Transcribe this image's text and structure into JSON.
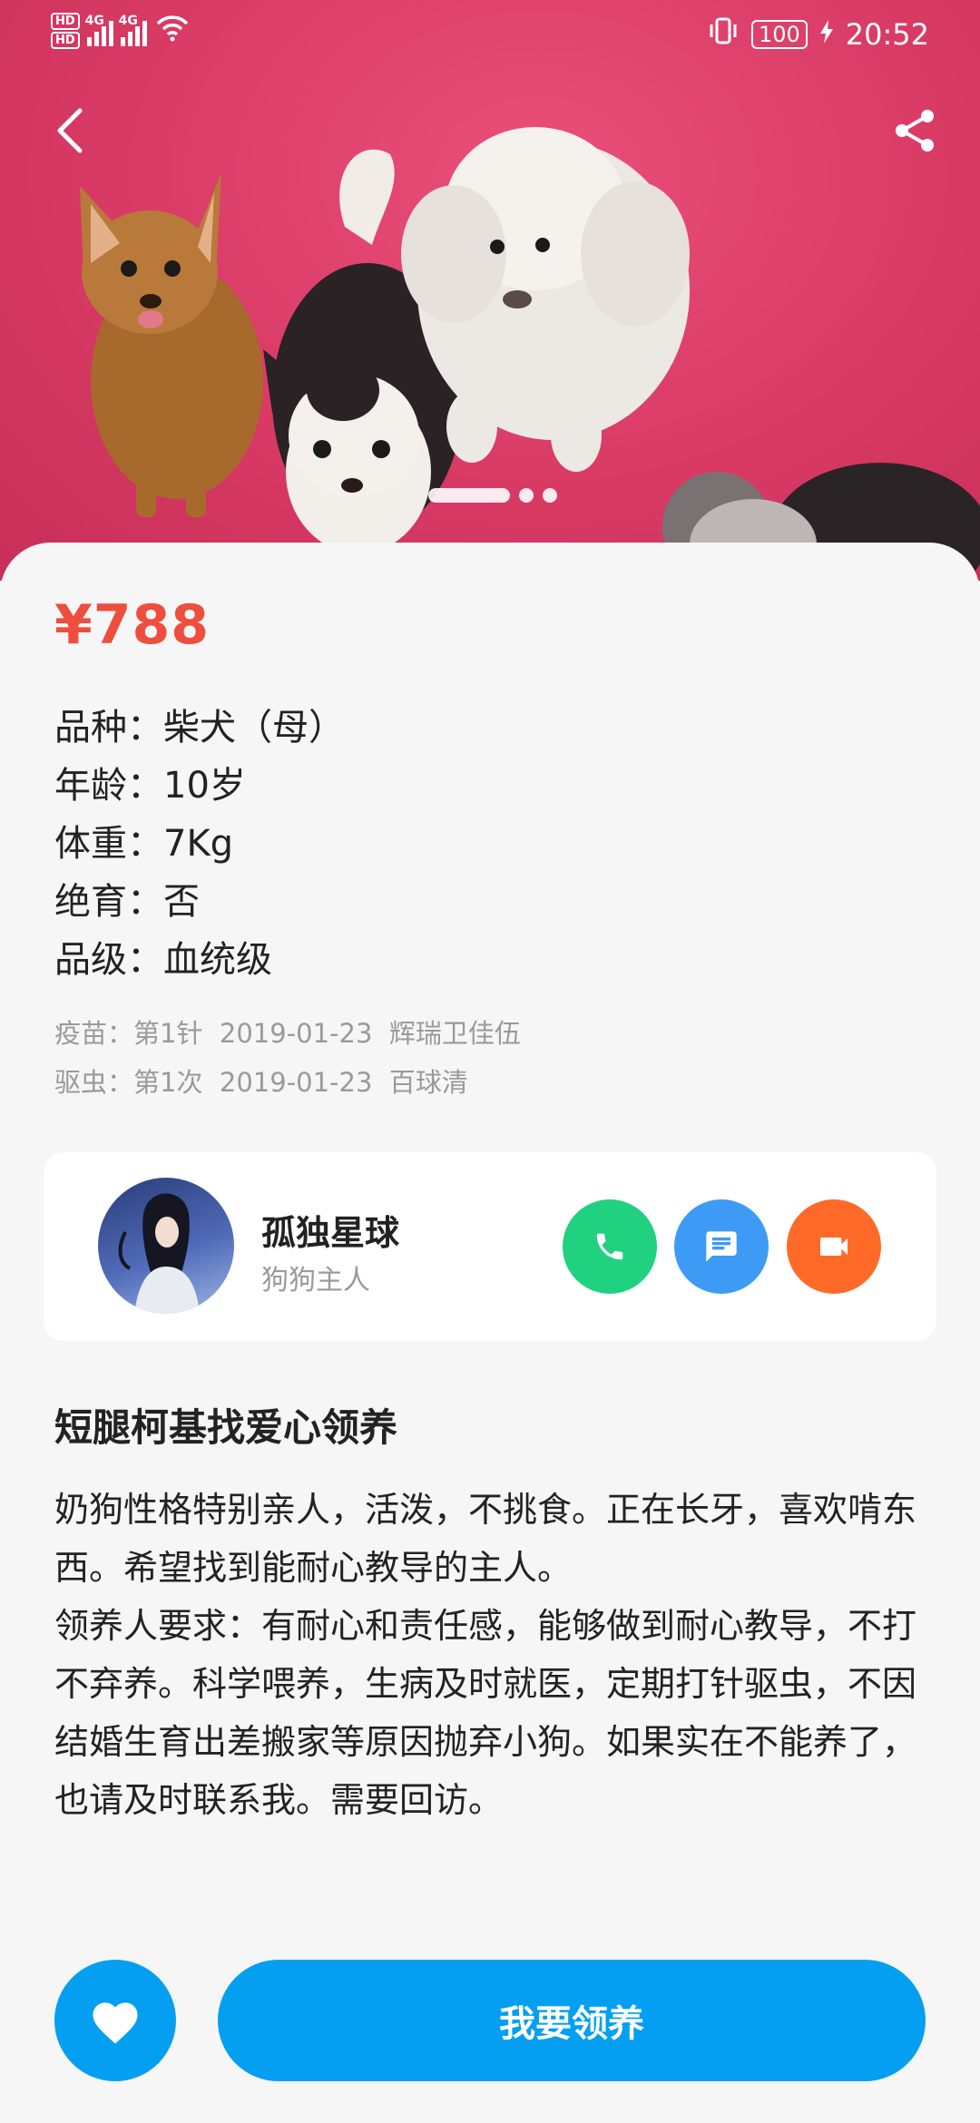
{
  "status_bar": {
    "hd1": "HD",
    "hd2": "HD",
    "net1": "4G",
    "net2": "4G",
    "battery": "100",
    "time": "20:52"
  },
  "nav": {
    "back_icon": "chevron-left-icon",
    "share_icon": "share-icon"
  },
  "carousel": {
    "slide_count": 3,
    "active_index": 0
  },
  "pet": {
    "price": "¥788",
    "details": [
      "品种：柴犬（母）",
      "年龄：10岁",
      "体重：7Kg",
      "绝育：否",
      "品级：血统级"
    ],
    "records": [
      "疫苗：第1针  2019-01-23  辉瑞卫佳伍",
      "驱虫：第1次  2019-01-23  百球清"
    ]
  },
  "owner": {
    "name": "孤独星球",
    "role": "狗狗主人",
    "actions": [
      {
        "name": "phone",
        "icon": "phone-icon",
        "color": "#20d17f"
      },
      {
        "name": "message",
        "icon": "chat-icon",
        "color": "#3d9bf5"
      },
      {
        "name": "video",
        "icon": "video-camera-icon",
        "color": "#ff6a29"
      }
    ]
  },
  "description": {
    "title": "短腿柯基找爱心领养",
    "paragraphs": [
      "奶狗性格特别亲人，活泼，不挑食。正在长牙，喜欢啃东西。希望找到能耐心教导的主人。",
      "领养人要求：有耐心和责任感，能够做到耐心教导，不打不弃养。科学喂养，生病及时就医，定期打针驱虫，不因结婚生育出差搬家等原因抛弃小狗。如果实在不能养了，也请及时联系我。需要回访。"
    ]
  },
  "actions": {
    "favorite_icon": "heart-icon",
    "adopt_label": "我要领养",
    "accent_color": "#049ff0",
    "price_color": "#ee4e3d"
  }
}
